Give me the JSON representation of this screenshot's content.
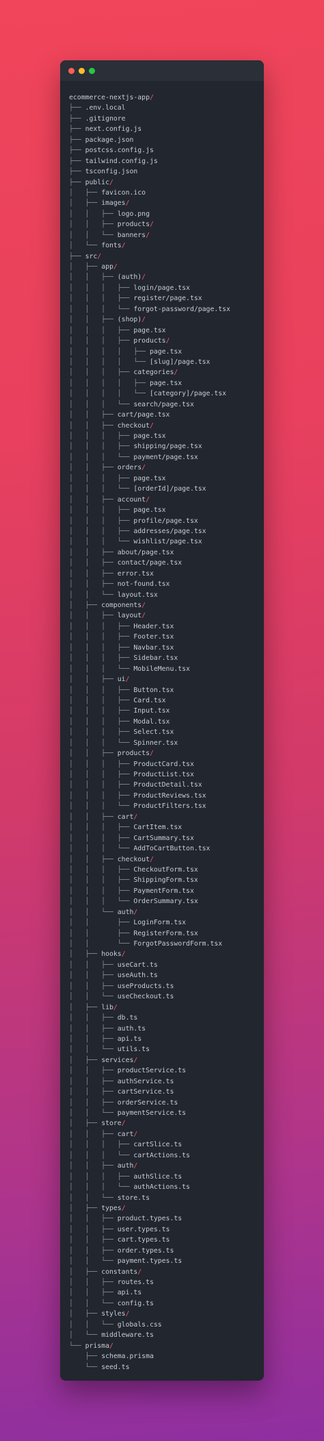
{
  "window": {
    "controls": {
      "close": "close",
      "minimize": "minimize",
      "zoom": "zoom"
    },
    "colors": {
      "close": "#ff5f57",
      "minimize": "#febc2e",
      "zoom": "#28c840",
      "slash": "#ef5a6b",
      "background": "#22262e"
    }
  },
  "tree": [
    {
      "indent": "",
      "name": "ecommerce-nextjs-app",
      "dir": true
    },
    {
      "indent": "├── ",
      "name": ".env.local",
      "dir": false
    },
    {
      "indent": "├── ",
      "name": ".gitignore",
      "dir": false
    },
    {
      "indent": "├── ",
      "name": "next.config.js",
      "dir": false
    },
    {
      "indent": "├── ",
      "name": "package.json",
      "dir": false
    },
    {
      "indent": "├── ",
      "name": "postcss.config.js",
      "dir": false
    },
    {
      "indent": "├── ",
      "name": "tailwind.config.js",
      "dir": false
    },
    {
      "indent": "├── ",
      "name": "tsconfig.json",
      "dir": false
    },
    {
      "indent": "├── ",
      "name": "public",
      "dir": true
    },
    {
      "indent": "│   ├── ",
      "name": "favicon.ico",
      "dir": false
    },
    {
      "indent": "│   ├── ",
      "name": "images",
      "dir": true
    },
    {
      "indent": "│   │   ├── ",
      "name": "logo.png",
      "dir": false
    },
    {
      "indent": "│   │   ├── ",
      "name": "products",
      "dir": true
    },
    {
      "indent": "│   │   └── ",
      "name": "banners",
      "dir": true
    },
    {
      "indent": "│   └── ",
      "name": "fonts",
      "dir": true
    },
    {
      "indent": "├── ",
      "name": "src",
      "dir": true
    },
    {
      "indent": "│   ├── ",
      "name": "app",
      "dir": true
    },
    {
      "indent": "│   │   ├── ",
      "name": "(auth)",
      "dir": true
    },
    {
      "indent": "│   │   │   ├── ",
      "name": "login/page.tsx",
      "dir": false
    },
    {
      "indent": "│   │   │   ├── ",
      "name": "register/page.tsx",
      "dir": false
    },
    {
      "indent": "│   │   │   └── ",
      "name": "forgot-password/page.tsx",
      "dir": false
    },
    {
      "indent": "│   │   ├── ",
      "name": "(shop)",
      "dir": true
    },
    {
      "indent": "│   │   │   ├── ",
      "name": "page.tsx",
      "dir": false
    },
    {
      "indent": "│   │   │   ├── ",
      "name": "products",
      "dir": true
    },
    {
      "indent": "│   │   │   │   ├── ",
      "name": "page.tsx",
      "dir": false
    },
    {
      "indent": "│   │   │   │   └── ",
      "name": "[slug]/page.tsx",
      "dir": false
    },
    {
      "indent": "│   │   │   ├── ",
      "name": "categories",
      "dir": true
    },
    {
      "indent": "│   │   │   │   ├── ",
      "name": "page.tsx",
      "dir": false
    },
    {
      "indent": "│   │   │   │   └── ",
      "name": "[category]/page.tsx",
      "dir": false
    },
    {
      "indent": "│   │   │   └── ",
      "name": "search/page.tsx",
      "dir": false
    },
    {
      "indent": "│   │   ├── ",
      "name": "cart/page.tsx",
      "dir": false
    },
    {
      "indent": "│   │   ├── ",
      "name": "checkout",
      "dir": true
    },
    {
      "indent": "│   │   │   ├── ",
      "name": "page.tsx",
      "dir": false
    },
    {
      "indent": "│   │   │   ├── ",
      "name": "shipping/page.tsx",
      "dir": false
    },
    {
      "indent": "│   │   │   └── ",
      "name": "payment/page.tsx",
      "dir": false
    },
    {
      "indent": "│   │   ├── ",
      "name": "orders",
      "dir": true
    },
    {
      "indent": "│   │   │   ├── ",
      "name": "page.tsx",
      "dir": false
    },
    {
      "indent": "│   │   │   └── ",
      "name": "[orderId]/page.tsx",
      "dir": false
    },
    {
      "indent": "│   │   ├── ",
      "name": "account",
      "dir": true
    },
    {
      "indent": "│   │   │   ├── ",
      "name": "page.tsx",
      "dir": false
    },
    {
      "indent": "│   │   │   ├── ",
      "name": "profile/page.tsx",
      "dir": false
    },
    {
      "indent": "│   │   │   ├── ",
      "name": "addresses/page.tsx",
      "dir": false
    },
    {
      "indent": "│   │   │   └── ",
      "name": "wishlist/page.tsx",
      "dir": false
    },
    {
      "indent": "│   │   ├── ",
      "name": "about/page.tsx",
      "dir": false
    },
    {
      "indent": "│   │   ├── ",
      "name": "contact/page.tsx",
      "dir": false
    },
    {
      "indent": "│   │   ├── ",
      "name": "error.tsx",
      "dir": false
    },
    {
      "indent": "│   │   ├── ",
      "name": "not-found.tsx",
      "dir": false
    },
    {
      "indent": "│   │   └── ",
      "name": "layout.tsx",
      "dir": false
    },
    {
      "indent": "│   ├── ",
      "name": "components",
      "dir": true
    },
    {
      "indent": "│   │   ├── ",
      "name": "layout",
      "dir": true
    },
    {
      "indent": "│   │   │   ├── ",
      "name": "Header.tsx",
      "dir": false
    },
    {
      "indent": "│   │   │   ├── ",
      "name": "Footer.tsx",
      "dir": false
    },
    {
      "indent": "│   │   │   ├── ",
      "name": "Navbar.tsx",
      "dir": false
    },
    {
      "indent": "│   │   │   ├── ",
      "name": "Sidebar.tsx",
      "dir": false
    },
    {
      "indent": "│   │   │   └── ",
      "name": "MobileMenu.tsx",
      "dir": false
    },
    {
      "indent": "│   │   ├── ",
      "name": "ui",
      "dir": true
    },
    {
      "indent": "│   │   │   ├── ",
      "name": "Button.tsx",
      "dir": false
    },
    {
      "indent": "│   │   │   ├── ",
      "name": "Card.tsx",
      "dir": false
    },
    {
      "indent": "│   │   │   ├── ",
      "name": "Input.tsx",
      "dir": false
    },
    {
      "indent": "│   │   │   ├── ",
      "name": "Modal.tsx",
      "dir": false
    },
    {
      "indent": "│   │   │   ├── ",
      "name": "Select.tsx",
      "dir": false
    },
    {
      "indent": "│   │   │   └── ",
      "name": "Spinner.tsx",
      "dir": false
    },
    {
      "indent": "│   │   ├── ",
      "name": "products",
      "dir": true
    },
    {
      "indent": "│   │   │   ├── ",
      "name": "ProductCard.tsx",
      "dir": false
    },
    {
      "indent": "│   │   │   ├── ",
      "name": "ProductList.tsx",
      "dir": false
    },
    {
      "indent": "│   │   │   ├── ",
      "name": "ProductDetail.tsx",
      "dir": false
    },
    {
      "indent": "│   │   │   ├── ",
      "name": "ProductReviews.tsx",
      "dir": false
    },
    {
      "indent": "│   │   │   └── ",
      "name": "ProductFilters.tsx",
      "dir": false
    },
    {
      "indent": "│   │   ├── ",
      "name": "cart",
      "dir": true
    },
    {
      "indent": "│   │   │   ├── ",
      "name": "CartItem.tsx",
      "dir": false
    },
    {
      "indent": "│   │   │   ├── ",
      "name": "CartSummary.tsx",
      "dir": false
    },
    {
      "indent": "│   │   │   └── ",
      "name": "AddToCartButton.tsx",
      "dir": false
    },
    {
      "indent": "│   │   ├── ",
      "name": "checkout",
      "dir": true
    },
    {
      "indent": "│   │   │   ├── ",
      "name": "CheckoutForm.tsx",
      "dir": false
    },
    {
      "indent": "│   │   │   ├── ",
      "name": "ShippingForm.tsx",
      "dir": false
    },
    {
      "indent": "│   │   │   ├── ",
      "name": "PaymentForm.tsx",
      "dir": false
    },
    {
      "indent": "│   │   │   └── ",
      "name": "OrderSummary.tsx",
      "dir": false
    },
    {
      "indent": "│   │   └── ",
      "name": "auth",
      "dir": true
    },
    {
      "indent": "│   │       ├── ",
      "name": "LoginForm.tsx",
      "dir": false
    },
    {
      "indent": "│   │       ├── ",
      "name": "RegisterForm.tsx",
      "dir": false
    },
    {
      "indent": "│   │       └── ",
      "name": "ForgotPasswordForm.tsx",
      "dir": false
    },
    {
      "indent": "│   ├── ",
      "name": "hooks",
      "dir": true
    },
    {
      "indent": "│   │   ├── ",
      "name": "useCart.ts",
      "dir": false
    },
    {
      "indent": "│   │   ├── ",
      "name": "useAuth.ts",
      "dir": false
    },
    {
      "indent": "│   │   ├── ",
      "name": "useProducts.ts",
      "dir": false
    },
    {
      "indent": "│   │   └── ",
      "name": "useCheckout.ts",
      "dir": false
    },
    {
      "indent": "│   ├── ",
      "name": "lib",
      "dir": true
    },
    {
      "indent": "│   │   ├── ",
      "name": "db.ts",
      "dir": false
    },
    {
      "indent": "│   │   ├── ",
      "name": "auth.ts",
      "dir": false
    },
    {
      "indent": "│   │   ├── ",
      "name": "api.ts",
      "dir": false
    },
    {
      "indent": "│   │   └── ",
      "name": "utils.ts",
      "dir": false
    },
    {
      "indent": "│   ├── ",
      "name": "services",
      "dir": true
    },
    {
      "indent": "│   │   ├── ",
      "name": "productService.ts",
      "dir": false
    },
    {
      "indent": "│   │   ├── ",
      "name": "authService.ts",
      "dir": false
    },
    {
      "indent": "│   │   ├── ",
      "name": "cartService.ts",
      "dir": false
    },
    {
      "indent": "│   │   ├── ",
      "name": "orderService.ts",
      "dir": false
    },
    {
      "indent": "│   │   └── ",
      "name": "paymentService.ts",
      "dir": false
    },
    {
      "indent": "│   ├── ",
      "name": "store",
      "dir": true
    },
    {
      "indent": "│   │   ├── ",
      "name": "cart",
      "dir": true
    },
    {
      "indent": "│   │   │   ├── ",
      "name": "cartSlice.ts",
      "dir": false
    },
    {
      "indent": "│   │   │   └── ",
      "name": "cartActions.ts",
      "dir": false
    },
    {
      "indent": "│   │   ├── ",
      "name": "auth",
      "dir": true
    },
    {
      "indent": "│   │   │   ├── ",
      "name": "authSlice.ts",
      "dir": false
    },
    {
      "indent": "│   │   │   └── ",
      "name": "authActions.ts",
      "dir": false
    },
    {
      "indent": "│   │   └── ",
      "name": "store.ts",
      "dir": false
    },
    {
      "indent": "│   ├── ",
      "name": "types",
      "dir": true
    },
    {
      "indent": "│   │   ├── ",
      "name": "product.types.ts",
      "dir": false
    },
    {
      "indent": "│   │   ├── ",
      "name": "user.types.ts",
      "dir": false
    },
    {
      "indent": "│   │   ├── ",
      "name": "cart.types.ts",
      "dir": false
    },
    {
      "indent": "│   │   ├── ",
      "name": "order.types.ts",
      "dir": false
    },
    {
      "indent": "│   │   └── ",
      "name": "payment.types.ts",
      "dir": false
    },
    {
      "indent": "│   ├── ",
      "name": "constants",
      "dir": true
    },
    {
      "indent": "│   │   ├── ",
      "name": "routes.ts",
      "dir": false
    },
    {
      "indent": "│   │   ├── ",
      "name": "api.ts",
      "dir": false
    },
    {
      "indent": "│   │   └── ",
      "name": "config.ts",
      "dir": false
    },
    {
      "indent": "│   ├── ",
      "name": "styles",
      "dir": true
    },
    {
      "indent": "│   │   └── ",
      "name": "globals.css",
      "dir": false
    },
    {
      "indent": "│   └── ",
      "name": "middleware.ts",
      "dir": false
    },
    {
      "indent": "└── ",
      "name": "prisma",
      "dir": true
    },
    {
      "indent": "    ├── ",
      "name": "schema.prisma",
      "dir": false
    },
    {
      "indent": "    └── ",
      "name": "seed.ts",
      "dir": false
    }
  ]
}
